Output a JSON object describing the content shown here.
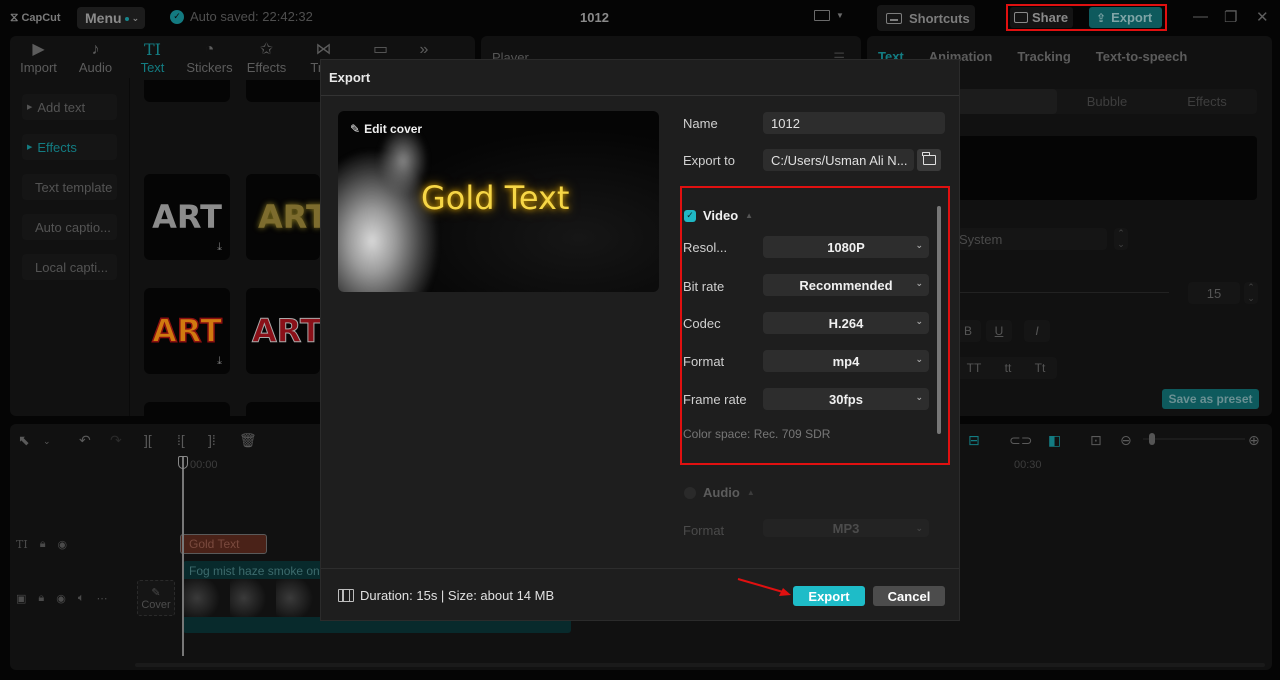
{
  "titlebar": {
    "logo": "CapCut",
    "menu_label": "Menu",
    "autosave": "Auto saved: 22:42:32",
    "project_title": "1012",
    "shortcuts_label": "Shortcuts",
    "share_label": "Share",
    "export_label": "Export",
    "accent": "#137c82"
  },
  "media_toolbar": {
    "tabs": [
      {
        "label": "Import",
        "icon": "import-icon"
      },
      {
        "label": "Audio",
        "icon": "audio-icon"
      },
      {
        "label": "Text",
        "icon": "text-icon",
        "active": true
      },
      {
        "label": "Stickers",
        "icon": "stickers-icon"
      },
      {
        "label": "Effects",
        "icon": "effects-icon"
      },
      {
        "label": "Tran",
        "icon": "transitions-icon"
      },
      {
        "label": "",
        "icon": "captions-icon"
      }
    ]
  },
  "text_sidebar": {
    "items": [
      {
        "label": "Add text",
        "expandable": true
      },
      {
        "label": "Effects",
        "expandable": true,
        "active": true
      },
      {
        "label": "Text template"
      },
      {
        "label": "Auto captio..."
      },
      {
        "label": "Local capti..."
      }
    ]
  },
  "art_presets": [
    {
      "label": "ART",
      "style": "plain-white"
    },
    {
      "label": "ART",
      "style": "gold-glow"
    },
    {
      "label": "ART",
      "style": "fire-gradient"
    },
    {
      "label": "ART",
      "style": "red-outline"
    }
  ],
  "player": {
    "title": "Player"
  },
  "inspector": {
    "tabs": [
      "Text",
      "Animation",
      "Tracking",
      "Text-to-speech"
    ],
    "segments": [
      "",
      "Bubble",
      "Effects"
    ],
    "font": "System",
    "font_size": "15",
    "format_buttons": [
      "B",
      "U",
      "I"
    ],
    "case_buttons": [
      "TT",
      "tt",
      "Tt"
    ],
    "save_preset_label": "Save as preset"
  },
  "timeline": {
    "ruler_start": "00:00",
    "ruler_mid": "00:30",
    "text_clip": "Gold Text",
    "video_clip": "Fog mist haze smoke on",
    "cover_label": "Cover"
  },
  "export_dialog": {
    "title": "Export",
    "edit_cover_label": "Edit cover",
    "cover_text": "Gold Text",
    "name_label": "Name",
    "name_value": "1012",
    "export_to_label": "Export to",
    "export_to_value": "C:/Users/Usman Ali N...",
    "video": {
      "label": "Video",
      "enabled": true,
      "fields": [
        {
          "label": "Resol...",
          "value": "1080P"
        },
        {
          "label": "Bit rate",
          "value": "Recommended"
        },
        {
          "label": "Codec",
          "value": "H.264"
        },
        {
          "label": "Format",
          "value": "mp4"
        },
        {
          "label": "Frame rate",
          "value": "30fps"
        }
      ],
      "color_space": "Color space: Rec. 709 SDR"
    },
    "audio": {
      "label": "Audio",
      "enabled": false,
      "format_label": "Format",
      "format_value": "MP3"
    },
    "footer_info": "Duration: 15s | Size: about 14 MB",
    "export_button": "Export",
    "cancel_button": "Cancel",
    "accent": "#1ebcc8"
  }
}
